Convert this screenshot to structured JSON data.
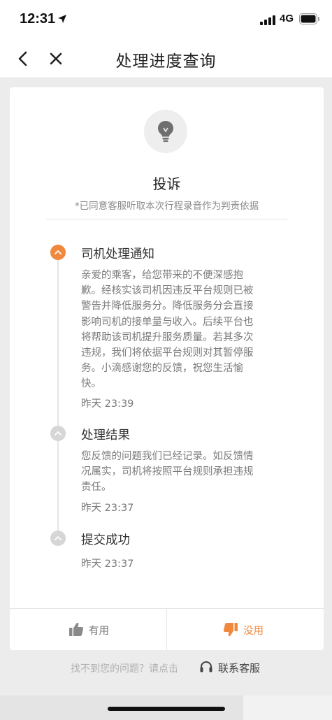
{
  "status_bar": {
    "time": "12:31",
    "network": "4G"
  },
  "nav": {
    "title": "处理进度查询"
  },
  "complaint": {
    "title": "投诉",
    "note": "*已同意客服听取本次行程录音作为判责依据"
  },
  "timeline": [
    {
      "title": "司机处理通知",
      "body_lines": [
        "亲爱的乘客，给您带来的不便深感抱",
        "歉。经核实该司机因违反平台规则已被",
        "警告并降低服务分。降低服务分会直接",
        "影响司机的接单量与收入。后续平台也",
        "将帮助该司机提升服务质量。若其多次",
        "违规，我们将依据平台规则对其暂停服",
        "务。小滴感谢您的反馈，祝您生活愉",
        "快。"
      ],
      "time": "昨天 23:39",
      "active": true
    },
    {
      "title": "处理结果",
      "body_lines": [
        "您反馈的问题我们已经记录。如反馈情",
        "况属实，司机将按照平台规则承担违规",
        "责任。"
      ],
      "time": "昨天 23:37",
      "active": false
    },
    {
      "title": "提交成功",
      "body_lines": [],
      "time": "昨天 23:37",
      "active": false
    }
  ],
  "feedback": {
    "useful_label": "有用",
    "useless_label": "没用"
  },
  "help": {
    "text": "找不到您的问题？请点击",
    "contact_label": "联系客服"
  },
  "colors": {
    "accent": "#f0883e",
    "inactive_dot": "#d6d6d6",
    "secondary_text": "#7a7a7a"
  },
  "icons": [
    "location-arrow-icon",
    "signal-icon",
    "battery-icon",
    "back-arrow-icon",
    "close-icon",
    "lightbulb-icon",
    "chevron-up-icon",
    "thumbs-up-icon",
    "thumbs-down-icon",
    "headset-icon"
  ]
}
